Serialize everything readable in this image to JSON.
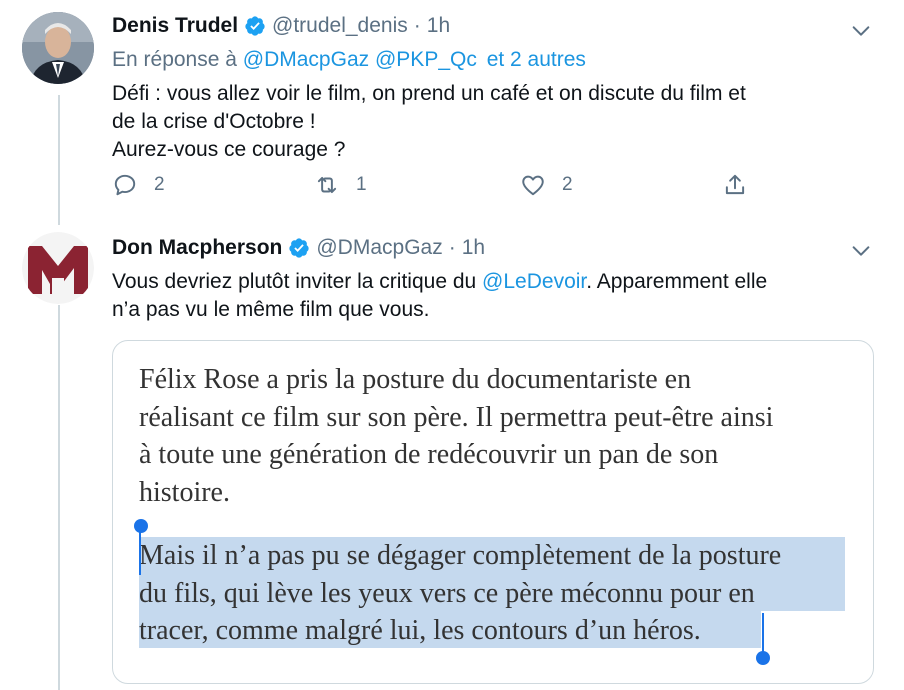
{
  "tweet1": {
    "name": "Denis Trudel",
    "handle": "@trudel_denis",
    "dot": "·",
    "time": "1h",
    "reply_prefix": "En réponse à",
    "reply_mention1": "@DMacpGaz",
    "reply_mention2": "@PKP_Qc",
    "reply_others": "et 2 autres",
    "text_line1": "Défi : vous allez voir le film, on prend un café et on discute du film  et",
    "text_line2": "de la crise d'Octobre !",
    "text_line3": "Aurez-vous ce courage ?",
    "reply_count": "2",
    "retweet_count": "1",
    "like_count": "2"
  },
  "tweet2": {
    "name": "Don Macpherson",
    "handle": "@DMacpGaz",
    "dot": "·",
    "time": "1h",
    "text_before": "Vous devriez plutôt inviter la critique du ",
    "text_mention": "@LeDevoir",
    "text_after": ". Apparemment elle",
    "text_line2": "n’a pas vu le même film que vous.",
    "avatar_letter": "M",
    "quote": {
      "para1_line1": "Félix Rose a pris la posture du documentariste en",
      "para1_line2": "réalisant ce film sur son père. Il permettra peut-être ainsi",
      "para1_line3": "à toute une génération de redécouvrir un pan de son",
      "para1_line4": "histoire.",
      "para2_line1": "Mais il n’a pas pu se dégager complètement de la posture",
      "para2_line2": "du fils, qui lève les yeux vers ce père méconnu pour en",
      "para2_line3": "tracer, comme malgré lui, les contours d’un héros."
    }
  },
  "colors": {
    "link": "#1b95e0",
    "muted": "#5b7083",
    "verified": "#1da1f2",
    "logo_maroon": "#8b2332",
    "selection": "#c5d9ee",
    "selection_handle": "#1a73e8"
  },
  "icons": [
    "verified-badge-icon",
    "chevron-down-icon",
    "reply-icon",
    "retweet-icon",
    "like-icon",
    "share-icon"
  ]
}
